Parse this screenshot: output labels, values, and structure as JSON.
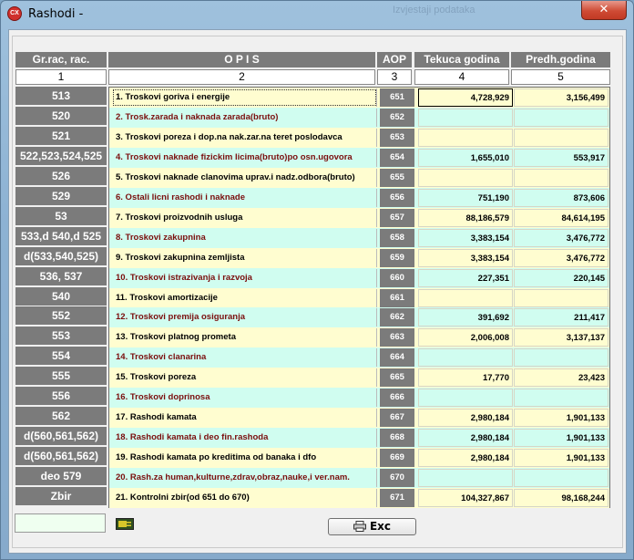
{
  "window": {
    "title": "Rashodi  -",
    "app_icon_text": "CX",
    "close_glyph": "✕",
    "background_ghost_text": "Izvjestaji podataka"
  },
  "headers": {
    "account": "Gr.rac, rac.",
    "opis": "O P I S",
    "aop": "AOP",
    "current_year": "Tekuca godina",
    "previous_year": "Predh.godina",
    "num_account": "1",
    "num_opis": "2",
    "num_aop": "3",
    "num_current": "4",
    "num_previous": "5"
  },
  "rows": [
    {
      "account": "513",
      "opis": "1. Troskovi goriva i energije",
      "aop": "651",
      "current": "4,728,929",
      "previous": "3,156,499"
    },
    {
      "account": "520",
      "opis": "2. Trosk.zarada i naknada zarada(bruto)",
      "aop": "652",
      "current": "",
      "previous": ""
    },
    {
      "account": "521",
      "opis": "3. Troskovi poreza i dop.na nak.zar.na teret poslodavca",
      "aop": "653",
      "current": "",
      "previous": ""
    },
    {
      "account": "522,523,524,525",
      "opis": "4. Troskovi naknade fizickim licima(bruto)po osn.ugovora",
      "aop": "654",
      "current": "1,655,010",
      "previous": "553,917"
    },
    {
      "account": "526",
      "opis": "5. Troskovi naknade clanovima uprav.i nadz.odbora(bruto)",
      "aop": "655",
      "current": "",
      "previous": ""
    },
    {
      "account": "529",
      "opis": "6. Ostali licni rashodi i naknade",
      "aop": "656",
      "current": "751,190",
      "previous": "873,606"
    },
    {
      "account": "53",
      "opis": "7. Troskovi proizvodnih usluga",
      "aop": "657",
      "current": "88,186,579",
      "previous": "84,614,195"
    },
    {
      "account": "533,d 540,d 525",
      "opis": "8. Troskovi zakupnina",
      "aop": "658",
      "current": "3,383,154",
      "previous": "3,476,772"
    },
    {
      "account": "d(533,540,525)",
      "opis": "9. Troskovi zakupnina zemljista",
      "aop": "659",
      "current": "3,383,154",
      "previous": "3,476,772"
    },
    {
      "account": "536, 537",
      "opis": "10. Troskovi istrazivanja i razvoja",
      "aop": "660",
      "current": "227,351",
      "previous": "220,145"
    },
    {
      "account": "540",
      "opis": "11. Troskovi amortizacije",
      "aop": "661",
      "current": "",
      "previous": ""
    },
    {
      "account": "552",
      "opis": "12. Troskovi premija osiguranja",
      "aop": "662",
      "current": "391,692",
      "previous": "211,417"
    },
    {
      "account": "553",
      "opis": "13. Troskovi platnog prometa",
      "aop": "663",
      "current": "2,006,008",
      "previous": "3,137,137"
    },
    {
      "account": "554",
      "opis": "14. Troskovi clanarina",
      "aop": "664",
      "current": "",
      "previous": ""
    },
    {
      "account": "555",
      "opis": "15. Troskovi poreza",
      "aop": "665",
      "current": "17,770",
      "previous": "23,423"
    },
    {
      "account": "556",
      "opis": "16. Troskovi doprinosa",
      "aop": "666",
      "current": "",
      "previous": ""
    },
    {
      "account": "562",
      "opis": "17. Rashodi kamata",
      "aop": "667",
      "current": "2,980,184",
      "previous": "1,901,133"
    },
    {
      "account": "d(560,561,562)",
      "opis": "18. Rashodi kamata i deo fin.rashoda",
      "aop": "668",
      "current": "2,980,184",
      "previous": "1,901,133"
    },
    {
      "account": "d(560,561,562)",
      "opis": "19. Rashodi kamata po kreditima od banaka i dfo",
      "aop": "669",
      "current": "2,980,184",
      "previous": "1,901,133"
    },
    {
      "account": "deo 579",
      "opis": "20. Rash.za human,kulturne,zdrav,obraz,nauke,i ver.nam.",
      "aop": "670",
      "current": "",
      "previous": ""
    },
    {
      "account": "Zbir",
      "opis": "21. Kontrolni zbir(od 651 do 670)",
      "aop": "671",
      "current": "104,327,867",
      "previous": "98,168,244"
    }
  ],
  "footer": {
    "status_value": "",
    "exit_button_label": "Exc",
    "plug_icon": "plug-icon",
    "exit_icon": "printer-exit-icon"
  },
  "colors": {
    "header_gray": "#7b7b7b",
    "row_yellow": "#fffdd0",
    "row_cyan": "#d0fdf0",
    "cyan_text": "#7a0d0d"
  }
}
